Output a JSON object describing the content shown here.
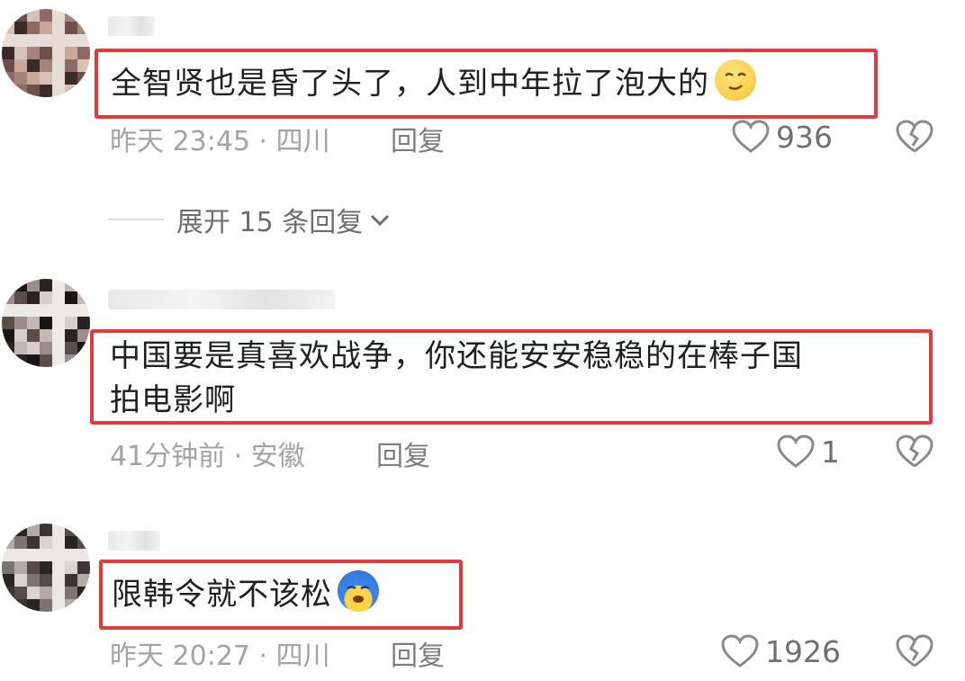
{
  "colors": {
    "highlight_border": "#e23b3b",
    "meta_text": "#a3a3a3",
    "count_text": "#707070"
  },
  "comments": [
    {
      "text": "全智贤也是昏了头了，人到中年拉了泡大的",
      "emoji": "smirk-face-emoji",
      "meta": "昨天 23:45 · 四川",
      "reply_label": "回复",
      "like_count": "936"
    },
    {
      "text_line1": "中国要是真喜欢战争，你还能安安稳稳的在棒子国",
      "text_line2": "拍电影啊",
      "meta": "41分钟前 · 安徽",
      "reply_label": "回复",
      "like_count": "1"
    },
    {
      "text": "限韩令就不该松",
      "emoji": "crying-face-emoji",
      "meta": "昨天 20:27 · 四川",
      "reply_label": "回复",
      "like_count": "1926"
    }
  ],
  "expand_replies": {
    "label": "展开 15 条回复"
  }
}
